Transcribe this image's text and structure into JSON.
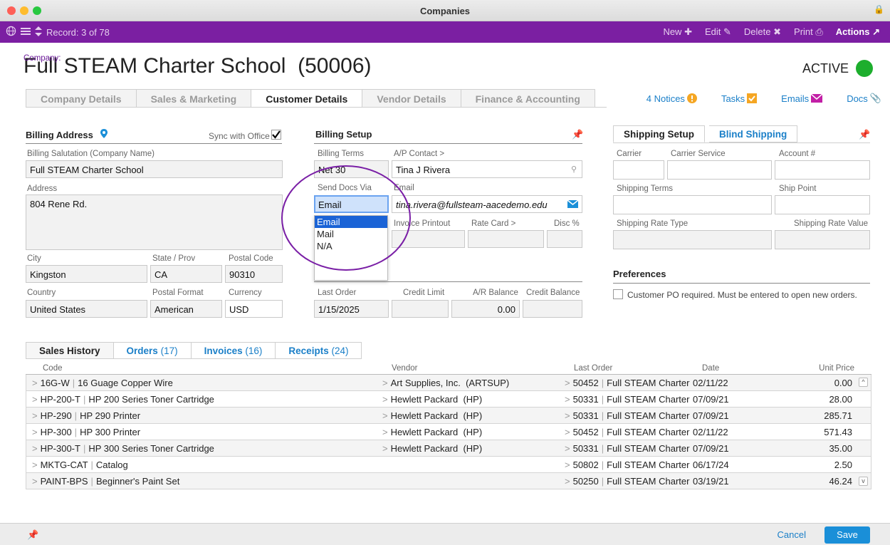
{
  "window": {
    "title": "Companies"
  },
  "toolbar": {
    "record": "Record: 3 of 78",
    "new": "New",
    "edit": "Edit",
    "delete": "Delete",
    "print": "Print",
    "actions": "Actions"
  },
  "header": {
    "label": "Company:",
    "name": "Full STEAM Charter School  (50006)",
    "status": "ACTIVE",
    "status_color": "#1dae2d"
  },
  "tabs": [
    {
      "label": "Company Details"
    },
    {
      "label": "Sales & Marketing"
    },
    {
      "label": "Customer Details"
    },
    {
      "label": "Vendor Details"
    },
    {
      "label": "Finance & Accounting"
    }
  ],
  "right_links": {
    "notices": "4 Notices",
    "tasks": "Tasks",
    "emails": "Emails",
    "docs": "Docs"
  },
  "billing_address": {
    "title": "Billing Address",
    "sync_label": "Sync with Office",
    "salutation_label": "Billing Salutation (Company Name)",
    "salutation": "Full STEAM Charter School",
    "address_label": "Address",
    "address": "804 Rene Rd.",
    "city_label": "City",
    "city": "Kingston",
    "state_label": "State / Prov",
    "state": "CA",
    "postal_label": "Postal Code",
    "postal": "90310",
    "country_label": "Country",
    "country": "United States",
    "postal_format_label": "Postal Format",
    "postal_format": "American",
    "currency_label": "Currency",
    "currency": "USD"
  },
  "billing_setup": {
    "title": "Billing Setup",
    "terms_label": "Billing Terms",
    "terms": "Net 30",
    "ap_label": "A/P Contact >",
    "ap_contact": "Tina J Rivera",
    "send_label": "Send Docs Via",
    "send_value": "Email",
    "email_label": "Email",
    "email": "tina.rivera@fullsteam-aacedemo.edu",
    "invoice_label": "Invoice Printout",
    "rate_label": "Rate Card >",
    "disc_label": "Disc %",
    "last_order_label": "Last Order",
    "last_order": "1/15/2025",
    "credit_limit_label": "Credit Limit",
    "ar_label": "A/R Balance",
    "ar_balance": "0.00",
    "credit_balance_label": "Credit Balance",
    "dropdown_options": [
      "Email",
      "Mail",
      "N/A"
    ]
  },
  "shipping": {
    "tab1": "Shipping Setup",
    "tab2": "Blind Shipping",
    "carrier_label": "Carrier",
    "carrier_service_label": "Carrier Service",
    "account_label": "Account #",
    "terms_label": "Shipping Terms",
    "ship_point_label": "Ship Point",
    "rate_type_label": "Shipping Rate Type",
    "rate_value_label": "Shipping Rate Value"
  },
  "preferences": {
    "title": "Preferences",
    "po_label": "Customer PO required. Must be entered to open new orders."
  },
  "bottom_tabs": [
    {
      "label": "Sales History",
      "count": ""
    },
    {
      "label": "Orders",
      "count": "(17)"
    },
    {
      "label": "Invoices",
      "count": "(16)"
    },
    {
      "label": "Receipts",
      "count": "(24)"
    }
  ],
  "table": {
    "headers": {
      "code": "Code",
      "vendor": "Vendor",
      "last_order": "Last Order",
      "date": "Date",
      "unit_price": "Unit Price"
    },
    "rows": [
      {
        "code": "16G-W",
        "desc": "16 Guage Copper Wire",
        "vendor": "Art Supplies, Inc.  (ARTSUP)",
        "order": "50452",
        "customer": "Full STEAM Charter",
        "date": "02/11/22",
        "price": "0.00"
      },
      {
        "code": "HP-200-T",
        "desc": "HP 200 Series Toner Cartridge",
        "vendor": "Hewlett Packard  (HP)",
        "order": "50331",
        "customer": "Full STEAM Charter",
        "date": "07/09/21",
        "price": "28.00"
      },
      {
        "code": "HP-290",
        "desc": "HP 290 Printer",
        "vendor": "Hewlett Packard  (HP)",
        "order": "50331",
        "customer": "Full STEAM Charter",
        "date": "07/09/21",
        "price": "285.71"
      },
      {
        "code": "HP-300",
        "desc": "HP 300 Printer",
        "vendor": "Hewlett Packard  (HP)",
        "order": "50452",
        "customer": "Full STEAM Charter",
        "date": "02/11/22",
        "price": "571.43"
      },
      {
        "code": "HP-300-T",
        "desc": "HP 300 Series Toner Cartridge",
        "vendor": "Hewlett Packard  (HP)",
        "order": "50331",
        "customer": "Full STEAM Charter",
        "date": "07/09/21",
        "price": "35.00"
      },
      {
        "code": "MKTG-CAT",
        "desc": "Catalog",
        "vendor": "",
        "order": "50802",
        "customer": "Full STEAM Charter",
        "date": "06/17/24",
        "price": "2.50"
      },
      {
        "code": "PAINT-BPS",
        "desc": "Beginner's Paint Set",
        "vendor": "",
        "order": "50250",
        "customer": "Full STEAM Charter",
        "date": "03/19/21",
        "price": "46.24"
      }
    ]
  },
  "footer": {
    "cancel": "Cancel",
    "save": "Save"
  }
}
